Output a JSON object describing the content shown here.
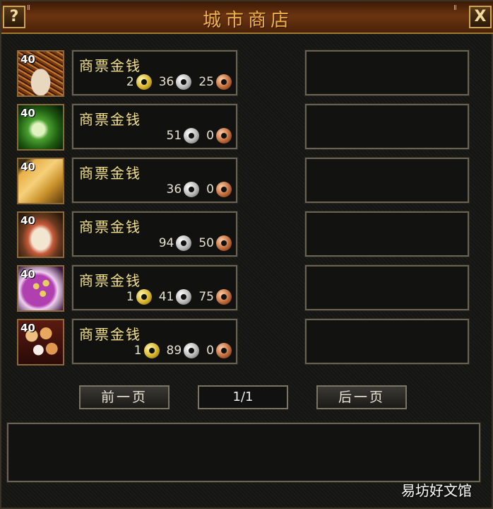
{
  "window": {
    "title": "城市商店",
    "help_label": "?",
    "close_label": "X",
    "corner_mark": "Ⅱ"
  },
  "items": [
    {
      "level": "40",
      "icon": "herbs-icon",
      "currency": "商票金钱",
      "prices": [
        {
          "value": "2",
          "coin": "gold"
        },
        {
          "value": "36",
          "coin": "silver"
        },
        {
          "value": "25",
          "coin": "copper"
        }
      ]
    },
    {
      "level": "40",
      "icon": "cabbage-icon",
      "currency": "商票金钱",
      "prices": [
        {
          "value": "51",
          "coin": "silver"
        },
        {
          "value": "0",
          "coin": "copper"
        }
      ]
    },
    {
      "level": "40",
      "icon": "tofu-skin-icon",
      "currency": "商票金钱",
      "prices": [
        {
          "value": "36",
          "coin": "silver"
        },
        {
          "value": "0",
          "coin": "copper"
        }
      ]
    },
    {
      "level": "40",
      "icon": "salt-meat-icon",
      "currency": "商票金钱",
      "prices": [
        {
          "value": "94",
          "coin": "silver"
        },
        {
          "value": "50",
          "coin": "copper"
        }
      ]
    },
    {
      "level": "40",
      "icon": "beans-bowl-icon",
      "currency": "商票金钱",
      "prices": [
        {
          "value": "1",
          "coin": "gold"
        },
        {
          "value": "41",
          "coin": "silver"
        },
        {
          "value": "75",
          "coin": "copper"
        }
      ]
    },
    {
      "level": "40",
      "icon": "longan-icon",
      "currency": "商票金钱",
      "prices": [
        {
          "value": "1",
          "coin": "gold"
        },
        {
          "value": "89",
          "coin": "silver"
        },
        {
          "value": "0",
          "coin": "copper"
        }
      ]
    }
  ],
  "pagination": {
    "prev_label": "前一页",
    "page": "1/1",
    "next_label": "后一页"
  },
  "watermark": "易坊好文馆",
  "colors": {
    "title_text": "#f0b048",
    "currency_text": "#f2e08a",
    "price_text": "#e6e2d0"
  }
}
